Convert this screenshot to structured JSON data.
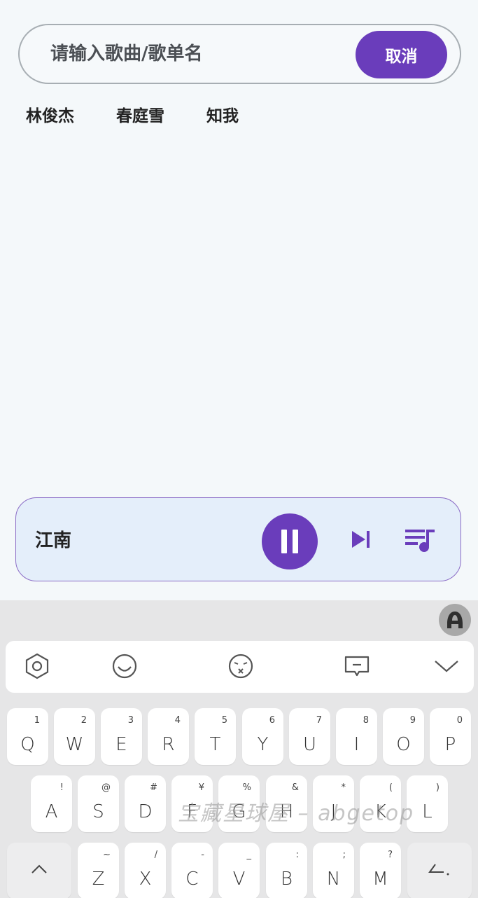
{
  "search": {
    "placeholder": "请输入歌曲/歌单名",
    "cancel_label": "取消"
  },
  "history": [
    "林俊杰",
    "春庭雪",
    "知我"
  ],
  "player": {
    "title": "江南",
    "pause_icon": "pause-icon",
    "next_icon": "skip-next-icon",
    "playlist_icon": "playlist-icon"
  },
  "keyboard": {
    "toolbar_icons": [
      "settings-hexagon-icon",
      "emoji-smile-icon",
      "emoji-face-icon",
      "clipboard-icon",
      "collapse-chevron-icon"
    ],
    "row1": [
      {
        "key": "Q",
        "sup": "1"
      },
      {
        "key": "W",
        "sup": "2"
      },
      {
        "key": "E",
        "sup": "3"
      },
      {
        "key": "R",
        "sup": "4"
      },
      {
        "key": "T",
        "sup": "5"
      },
      {
        "key": "Y",
        "sup": "6"
      },
      {
        "key": "U",
        "sup": "7"
      },
      {
        "key": "I",
        "sup": "8"
      },
      {
        "key": "O",
        "sup": "9"
      },
      {
        "key": "P",
        "sup": "0"
      }
    ],
    "row2": [
      {
        "key": "A",
        "sup": "!"
      },
      {
        "key": "S",
        "sup": "@"
      },
      {
        "key": "D",
        "sup": "#"
      },
      {
        "key": "F",
        "sup": "¥"
      },
      {
        "key": "G",
        "sup": "%"
      },
      {
        "key": "H",
        "sup": "&"
      },
      {
        "key": "J",
        "sup": "*"
      },
      {
        "key": "K",
        "sup": "("
      },
      {
        "key": "L",
        "sup": ")"
      }
    ],
    "row3": [
      {
        "key": "Z",
        "sup": "~"
      },
      {
        "key": "X",
        "sup": "/"
      },
      {
        "key": "C",
        "sup": "-"
      },
      {
        "key": "V",
        "sup": "_"
      },
      {
        "key": "B",
        "sup": ":"
      },
      {
        "key": "N",
        "sup": ";"
      },
      {
        "key": "M",
        "sup": "?"
      }
    ]
  },
  "watermark": "宝藏星球屋 – abgetop",
  "colors": {
    "accent": "#6a3dbb",
    "player_bg": "#e4eefa",
    "page_bg": "#f4f8fa"
  }
}
